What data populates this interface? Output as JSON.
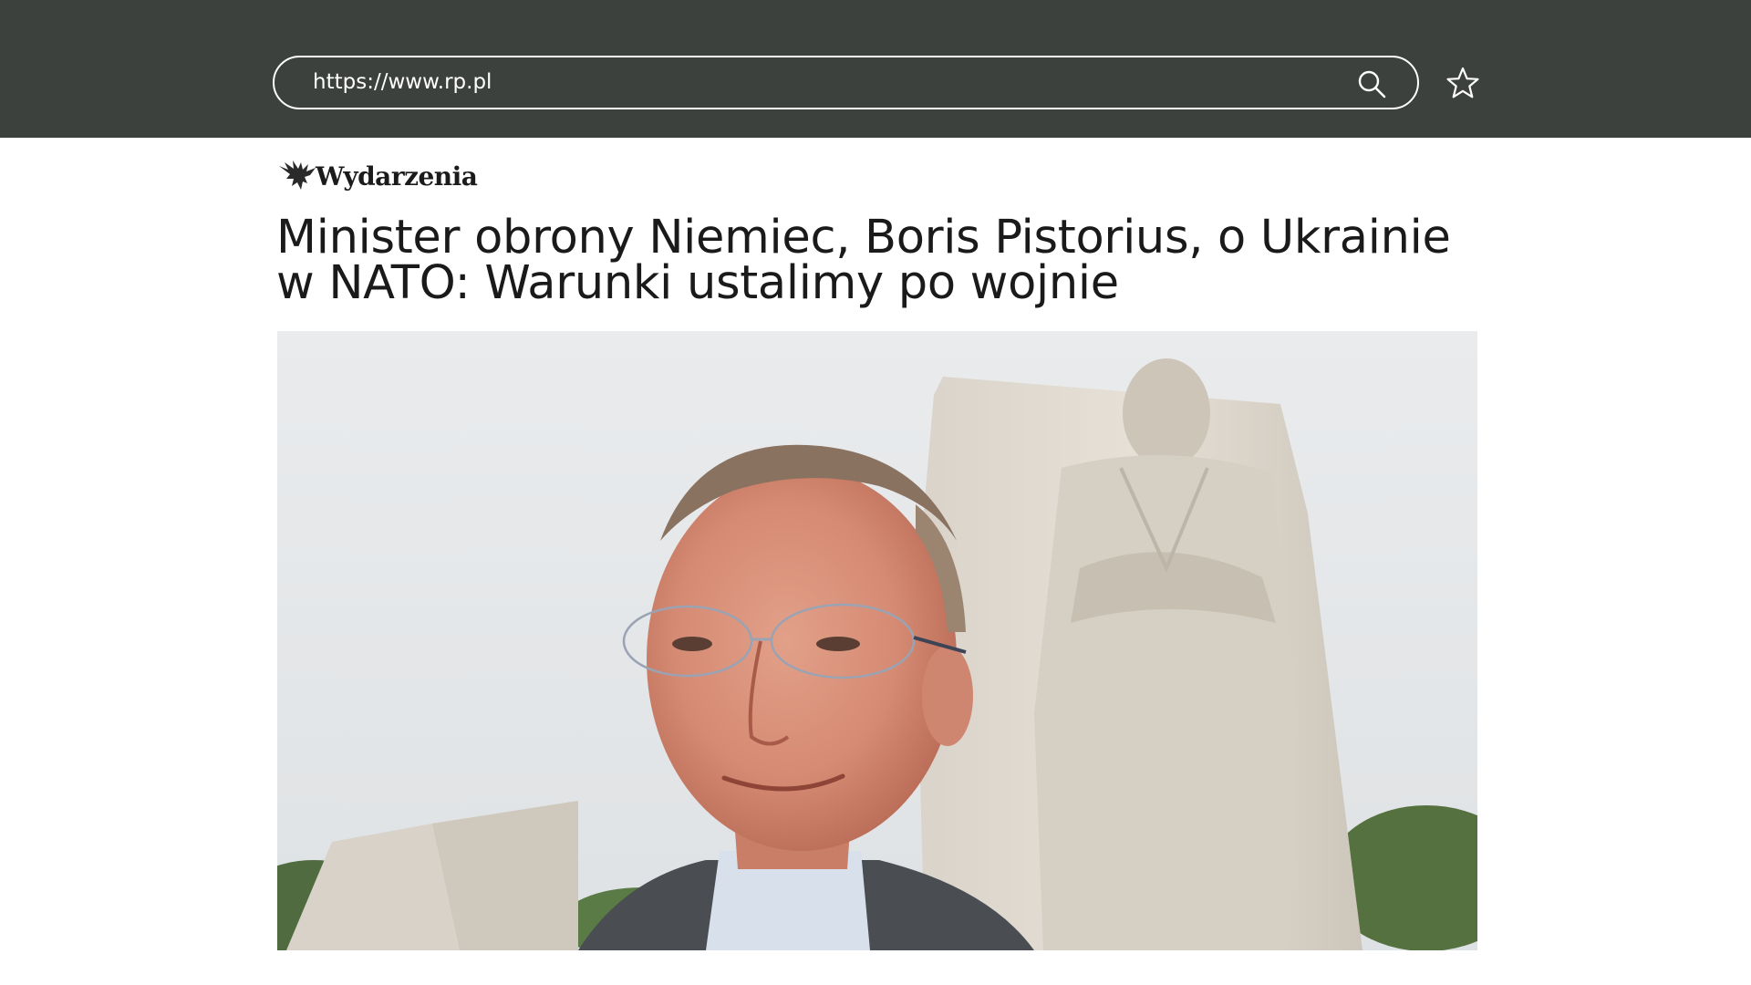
{
  "browser": {
    "url": "https://www.rp.pl"
  },
  "article": {
    "section": "Wydarzenia",
    "headline_line1": "Minister obrony Niemiec, Boris Pistorius, o Ukrainie",
    "headline_line2": "w NATO: Warunki ustalimy po wojnie"
  },
  "icons": {
    "search": "search-icon",
    "bookmark": "star-icon",
    "logo": "eagle-icon"
  },
  "colors": {
    "topbar": "#3d413d",
    "text": "#1a1a1a"
  }
}
